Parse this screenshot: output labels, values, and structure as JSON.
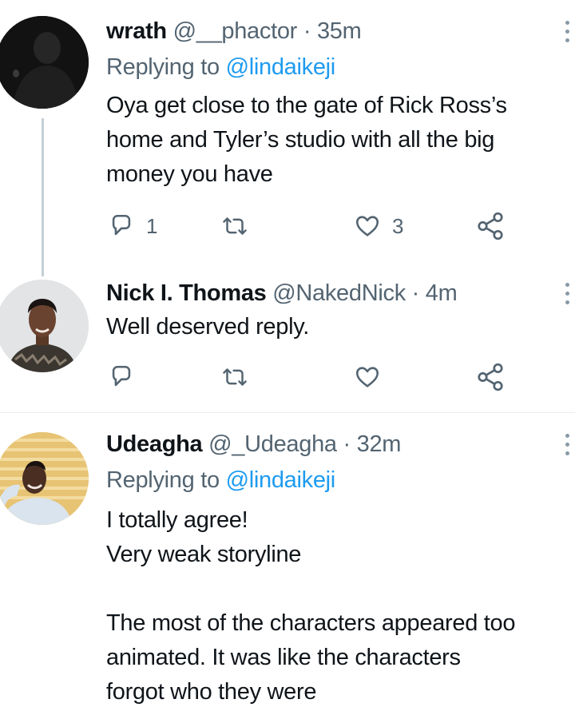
{
  "tweets": [
    {
      "name": "wrath",
      "handle": "@__phactor",
      "dot": "·",
      "time": "35m",
      "replying_prefix": "Replying to",
      "replying_to": "@lindaikeji",
      "lines": [
        "Oya get close to the gate of Rick Ross’s",
        "home and Tyler’s studio with all the big",
        "money you have"
      ],
      "reply_count": "1",
      "retweet_count": "",
      "like_count": "3",
      "avatar_icon": "silhouette-avatar"
    },
    {
      "name": "Nick I. Thomas",
      "handle": "@NakedNick",
      "dot": "·",
      "time": "4m",
      "lines": [
        "Well deserved reply."
      ],
      "reply_count": "",
      "retweet_count": "",
      "like_count": "",
      "avatar_icon": "person-photo-avatar"
    },
    {
      "name": "Udeagha",
      "handle": "@_Udeagha",
      "dot": "·",
      "time": "32m",
      "replying_prefix": "Replying to",
      "replying_to": "@lindaikeji",
      "lines": [
        "I totally agree!",
        "Very weak storyline",
        "",
        "The most of the characters appeared too",
        "animated. It was like the characters",
        "forgot who they were"
      ],
      "avatar_icon": "person-photo-avatar"
    }
  ],
  "icons": {
    "reply": "reply-icon",
    "retweet": "retweet-icon",
    "like": "heart-icon",
    "share": "share-icon",
    "more": "more-options-icon"
  },
  "colors": {
    "text": "#0f1419",
    "secondary": "#536471",
    "link": "#1d9bf0",
    "thread_line": "#c4cfd6"
  }
}
